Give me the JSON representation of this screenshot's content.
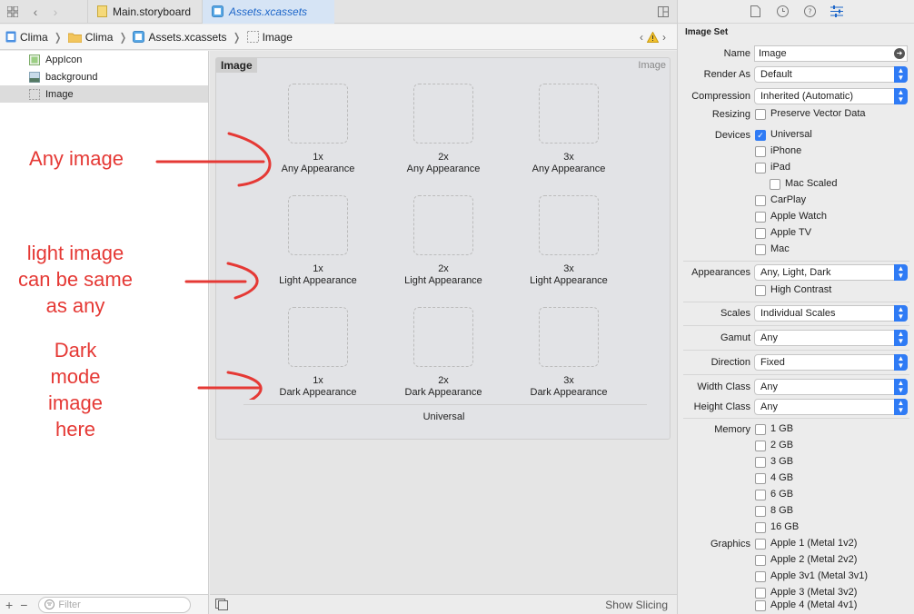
{
  "tabbar": {
    "tabs": [
      {
        "label": "Main.storyboard"
      },
      {
        "label": "Assets.xcassets"
      }
    ]
  },
  "breadcrumb": {
    "items": [
      "Clima",
      "Clima",
      "Assets.xcassets",
      "Image"
    ]
  },
  "navigator": {
    "items": [
      {
        "label": "AppIcon"
      },
      {
        "label": "background"
      },
      {
        "label": "Image"
      }
    ],
    "filter_placeholder": "Filter"
  },
  "editor": {
    "set_title": "Image",
    "set_type": "Image",
    "rows": [
      {
        "appearance": "Any Appearance",
        "scales": [
          "1x",
          "2x",
          "3x"
        ]
      },
      {
        "appearance": "Light Appearance",
        "scales": [
          "1x",
          "2x",
          "3x"
        ]
      },
      {
        "appearance": "Dark Appearance",
        "scales": [
          "1x",
          "2x",
          "3x"
        ]
      }
    ],
    "universal_label": "Universal",
    "show_slicing": "Show Slicing"
  },
  "annotations": {
    "any": "Any image",
    "light": "light image\ncan be same\nas any",
    "dark": "Dark\nmode\nimage\nhere",
    "color": "#e53935"
  },
  "inspector": {
    "header": "Image Set",
    "name_label": "Name",
    "name_value": "Image",
    "render_as_label": "Render As",
    "render_as_value": "Default",
    "compression_label": "Compression",
    "compression_value": "Inherited (Automatic)",
    "resizing_label": "Resizing",
    "resizing_option": "Preserve Vector Data",
    "devices_label": "Devices",
    "devices": [
      {
        "label": "Universal",
        "checked": true,
        "indent": false
      },
      {
        "label": "iPhone",
        "checked": false,
        "indent": false
      },
      {
        "label": "iPad",
        "checked": false,
        "indent": false
      },
      {
        "label": "Mac Scaled",
        "checked": false,
        "indent": true
      },
      {
        "label": "CarPlay",
        "checked": false,
        "indent": false
      },
      {
        "label": "Apple Watch",
        "checked": false,
        "indent": false
      },
      {
        "label": "Apple TV",
        "checked": false,
        "indent": false
      },
      {
        "label": "Mac",
        "checked": false,
        "indent": false
      }
    ],
    "appearances_label": "Appearances",
    "appearances_value": "Any, Light, Dark",
    "high_contrast": "High Contrast",
    "scales_label": "Scales",
    "scales_value": "Individual Scales",
    "gamut_label": "Gamut",
    "gamut_value": "Any",
    "direction_label": "Direction",
    "direction_value": "Fixed",
    "width_class_label": "Width Class",
    "width_class_value": "Any",
    "height_class_label": "Height Class",
    "height_class_value": "Any",
    "memory_label": "Memory",
    "memory": [
      "1 GB",
      "2 GB",
      "3 GB",
      "4 GB",
      "6 GB",
      "8 GB",
      "16 GB"
    ],
    "graphics_label": "Graphics",
    "graphics": [
      "Apple 1 (Metal 1v2)",
      "Apple 2 (Metal 2v2)",
      "Apple 3v1 (Metal 3v1)",
      "Apple 3 (Metal 3v2)",
      "Apple 4 (Metal 4v1)"
    ],
    "accent": "#2f7bf5"
  }
}
